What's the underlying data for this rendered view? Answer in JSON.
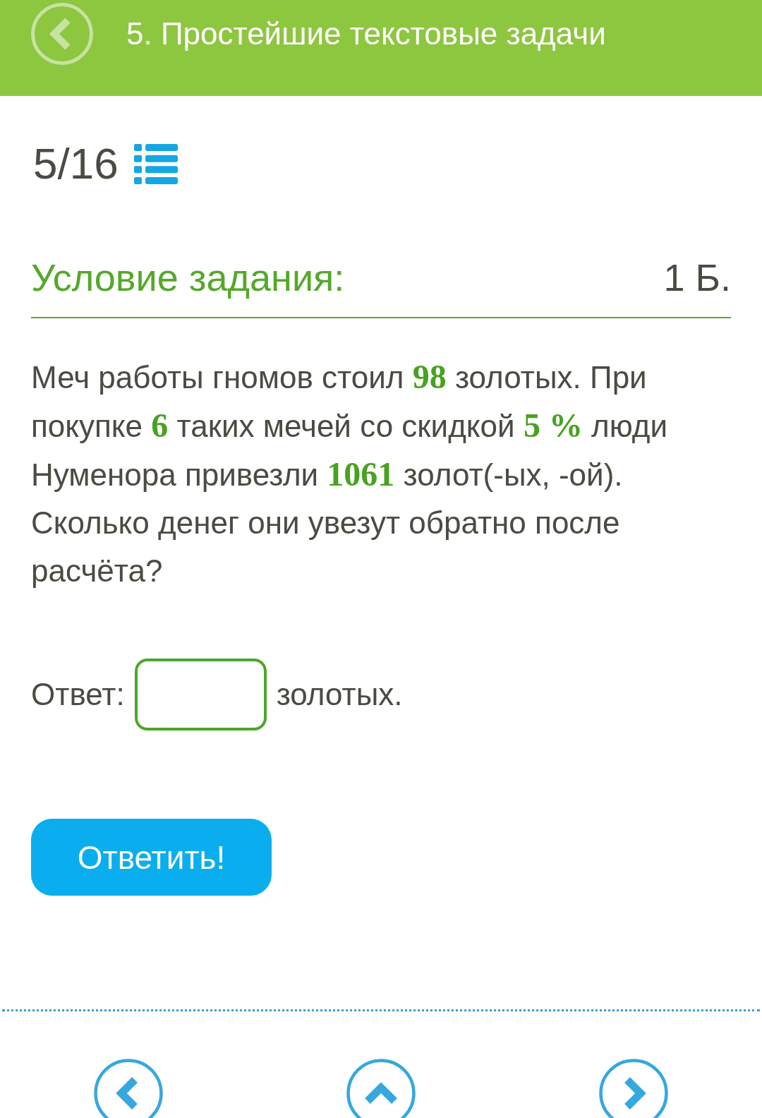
{
  "header": {
    "title": "5. Простейшие текстовые задачи"
  },
  "progress": {
    "counter": "5/16"
  },
  "task": {
    "heading": "Условие задания:",
    "points": "1 Б.",
    "statement": "Меч работы гномов стоил **98** золотых. При покупке **6** таких мечей со скидкой **5 %** люди Нуменора привезли **1061** золот(-ых, -ой). Сколько денег они увезут обратно после расчёта?"
  },
  "answer": {
    "label": "Ответ:",
    "unit": "золотых."
  },
  "submit_button": {
    "label": "Ответить!"
  }
}
